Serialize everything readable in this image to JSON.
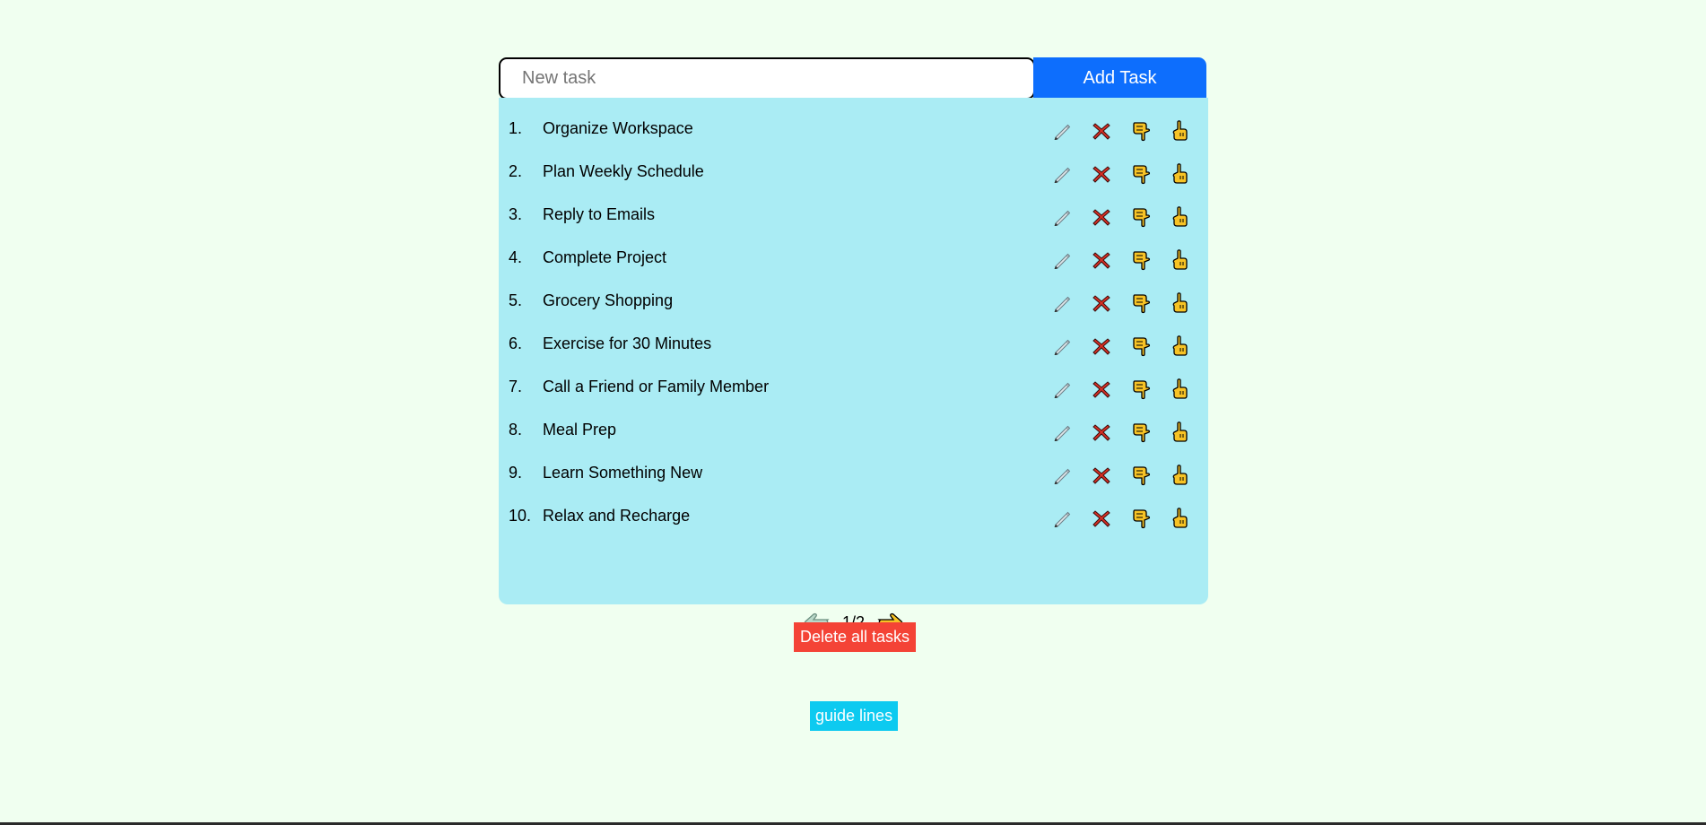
{
  "input": {
    "placeholder": "New task",
    "value": ""
  },
  "add_button": {
    "label": "Add Task"
  },
  "tasks": [
    {
      "num": "1.",
      "text": "Organize Workspace"
    },
    {
      "num": "2.",
      "text": "Plan Weekly Schedule"
    },
    {
      "num": "3.",
      "text": "Reply to Emails"
    },
    {
      "num": "4.",
      "text": "Complete Project"
    },
    {
      "num": "5.",
      "text": "Grocery Shopping"
    },
    {
      "num": "6.",
      "text": "Exercise for 30 Minutes"
    },
    {
      "num": "7.",
      "text": "Call a Friend or Family Member"
    },
    {
      "num": "8.",
      "text": "Meal Prep"
    },
    {
      "num": "9.",
      "text": "Learn Something New"
    },
    {
      "num": "10.",
      "text": "Relax and Recharge"
    }
  ],
  "task_actions": [
    "pencil-icon",
    "delete-x-icon",
    "move-down-hand-icon",
    "move-up-hand-icon"
  ],
  "pagination": {
    "text": "1/2",
    "prev_icon": "hand-pointing-left-icon",
    "next_icon": "hand-pointing-right-icon"
  },
  "delete_all": {
    "label": "Delete all tasks"
  },
  "guide": {
    "label": "guide lines"
  },
  "colors": {
    "background": "#f0fff0",
    "panel": "#aaecf4",
    "add_button": "#0d6efd",
    "delete_button": "#f44336",
    "guide_button": "#0dcaf0",
    "hand_icon": "#f7c325",
    "delete_icon": "#d93025"
  }
}
